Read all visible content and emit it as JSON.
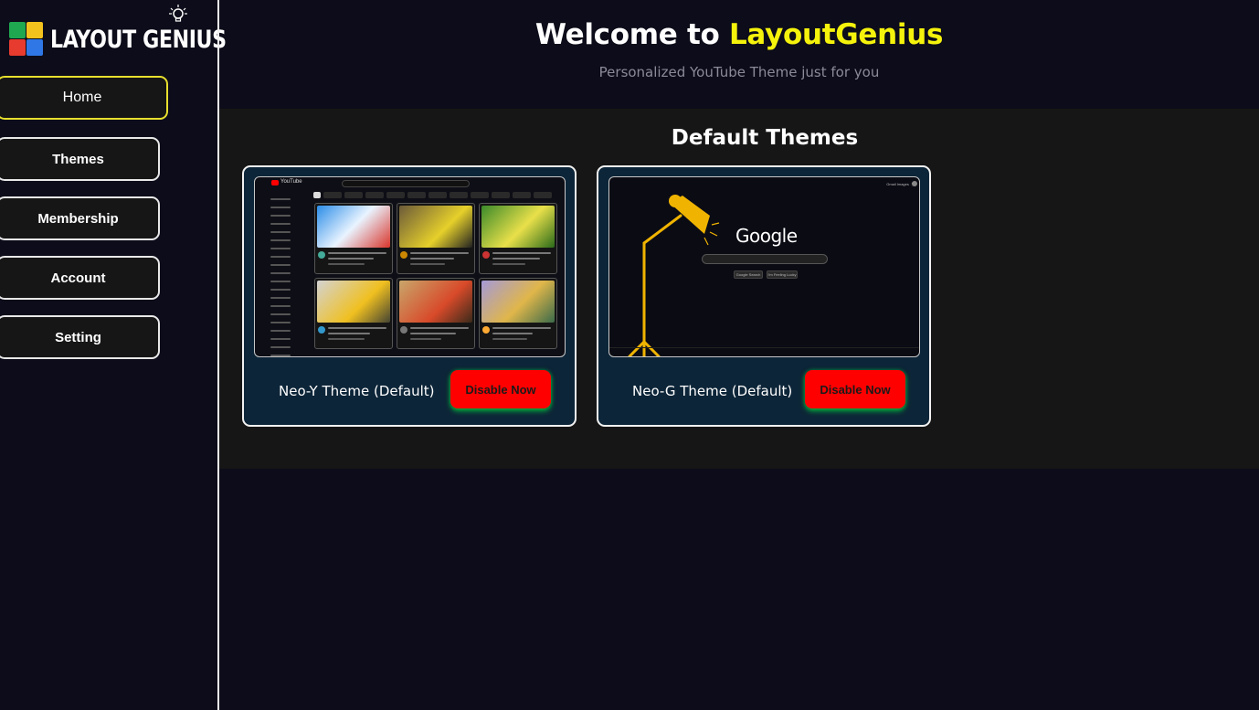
{
  "sidebar": {
    "logo_text": "LAYOUT GENIUS",
    "items": [
      {
        "label": "Home",
        "active": true
      },
      {
        "label": "Themes"
      },
      {
        "label": "Membership"
      },
      {
        "label": "Account"
      },
      {
        "label": "Setting"
      }
    ]
  },
  "header": {
    "welcome_prefix": "Welcome to",
    "brand": "LayoutGenius",
    "subtitle": "Personalized YouTube Theme just for you"
  },
  "themes_section": {
    "title": "Default Themes",
    "cards": [
      {
        "label": "Neo-Y Theme (Default)",
        "button": "Disable Now",
        "preview_icon": "youtube-preview"
      },
      {
        "label": "Neo-G Theme (Default)",
        "button": "Disable Now",
        "preview_icon": "google-preview"
      }
    ]
  },
  "previews": {
    "google_logo": "Google"
  },
  "colors": {
    "brand_yellow": "#f5f20c",
    "disable_red": "#ff0000",
    "card_bg": "#0d2538",
    "page_bg": "#0c0c1a"
  }
}
